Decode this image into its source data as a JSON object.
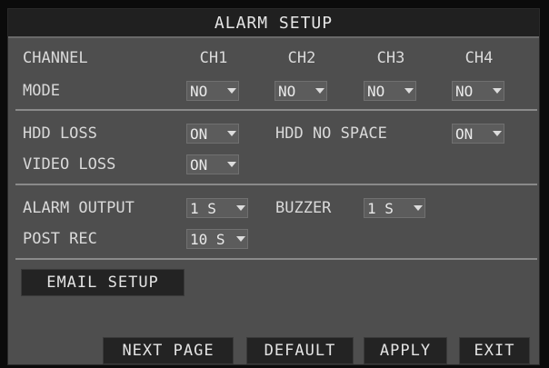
{
  "title": "ALARM SETUP",
  "labels": {
    "channel": "CHANNEL",
    "mode": "MODE",
    "hdd_loss": "HDD LOSS",
    "hdd_no_space": "HDD NO SPACE",
    "video_loss": "VIDEO LOSS",
    "alarm_output": "ALARM OUTPUT",
    "buzzer": "BUZZER",
    "post_rec": "POST REC"
  },
  "channels": [
    "CH1",
    "CH2",
    "CH3",
    "CH4"
  ],
  "modes": [
    "NO",
    "NO",
    "NO",
    "NO"
  ],
  "values": {
    "hdd_loss": "ON",
    "hdd_no_space": "ON",
    "video_loss": "ON",
    "alarm_output": "1 S",
    "buzzer": "1 S",
    "post_rec": "10 S"
  },
  "buttons": {
    "email_setup": "EMAIL SETUP",
    "next_page": "NEXT PAGE",
    "default": "DEFAULT",
    "apply": "APPLY",
    "exit": "EXIT"
  },
  "icons": {
    "dropdown": "dropdown-arrow-icon"
  },
  "colors": {
    "panel": "#4e4e4e",
    "titlebar": "#202020",
    "button": "#232323",
    "text": "#d9d9d9"
  }
}
